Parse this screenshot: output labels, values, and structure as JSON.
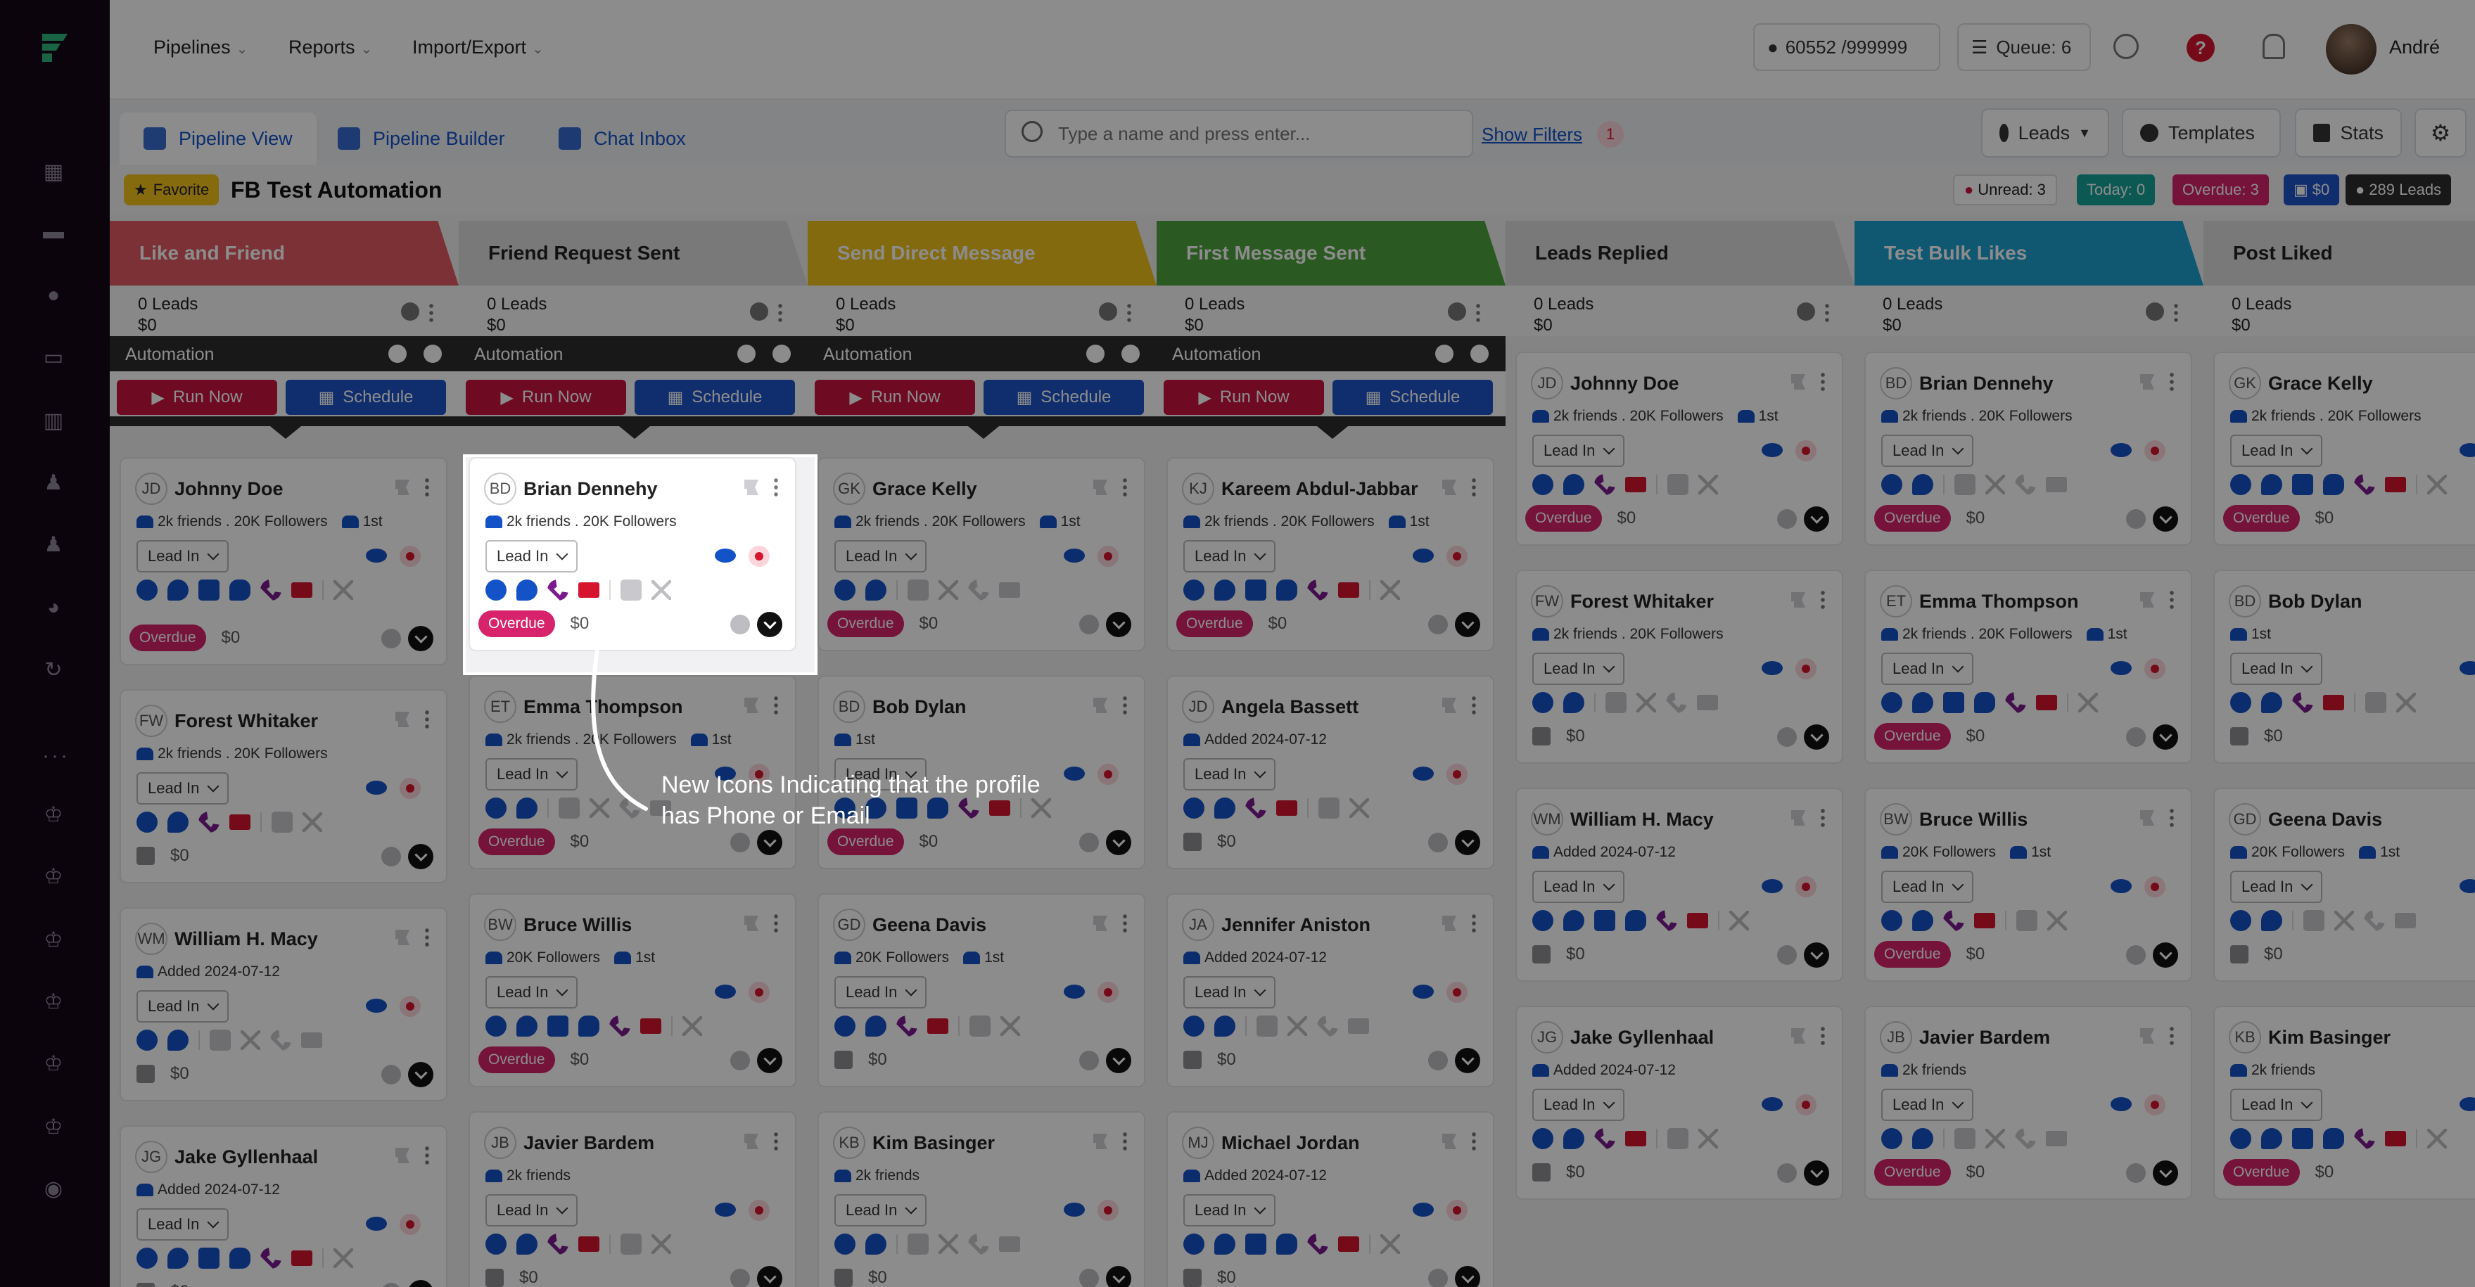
{
  "app": {
    "brand_icon": "logo-icon",
    "user": "André"
  },
  "nav": {
    "items": [
      "Pipelines",
      "Reports",
      "Import/Export"
    ],
    "counter": "60552 /999999",
    "queue": "Queue: 6",
    "help": "?"
  },
  "tabs": [
    "Pipeline View",
    "Pipeline Builder",
    "Chat Inbox"
  ],
  "search": {
    "placeholder": "Type a name and press enter...",
    "filters": "Show Filters",
    "filter_count": "1"
  },
  "actions": {
    "leads": "Leads",
    "templates": "Templates",
    "stats": "Stats"
  },
  "pipeline": {
    "favorite": "Favorite",
    "title": "FB Test Automation"
  },
  "stats": {
    "unread": "Unread: 3",
    "today": "Today: 0",
    "overdue": "Overdue: 3",
    "money": "$0",
    "leads": "289 Leads",
    "colors": {
      "unread": "#c9133f",
      "today": "#17a39a",
      "overdue": "#d6236b",
      "money": "#1e54c8",
      "leads": "#2d2d2f"
    }
  },
  "automation": {
    "label": "Automation",
    "run": "Run Now",
    "schedule": "Schedule"
  },
  "common": {
    "lead_status": "Lead In",
    "amount": "$0",
    "overdue": "Overdue"
  },
  "columns": [
    {
      "name": "Like and Friend",
      "leads": "0 Leads",
      "amount": "$0",
      "color": "#e05a63",
      "auto": true,
      "cards": [
        {
          "ini": "JD",
          "name": "Johnny Doe",
          "meta": "2k friends . 20K Followers",
          "conn": "1st",
          "overdue": true
        },
        {
          "ini": "FW",
          "name": "Forest Whitaker",
          "meta": "2k friends . 20K Followers",
          "conn": "",
          "overdue": false
        },
        {
          "ini": "WM",
          "name": "William H. Macy",
          "meta": "Added 2024-07-12",
          "conn": "",
          "overdue": false
        },
        {
          "ini": "JG",
          "name": "Jake Gyllenhaal",
          "meta": "Added 2024-07-12",
          "conn": "",
          "overdue": false
        }
      ]
    },
    {
      "name": "Friend Request Sent",
      "leads": "0 Leads",
      "amount": "$0",
      "color": "#dcdcdf",
      "auto": true,
      "cards": [
        {
          "ini": "BD",
          "name": "Brian Dennehy",
          "meta": "2k friends . 20K Followers",
          "conn": "",
          "overdue": true
        },
        {
          "ini": "ET",
          "name": "Emma Thompson",
          "meta": "2k friends . 20K Followers",
          "conn": "1st",
          "overdue": true
        },
        {
          "ini": "BW",
          "name": "Bruce Willis",
          "meta": "20K Followers",
          "conn": "1st",
          "overdue": true
        },
        {
          "ini": "JB",
          "name": "Javier Bardem",
          "meta": "2k friends",
          "conn": "",
          "overdue": false
        }
      ]
    },
    {
      "name": "Send Direct Message",
      "leads": "0 Leads",
      "amount": "$0",
      "color": "#f1c21b",
      "auto": true,
      "cards": [
        {
          "ini": "GK",
          "name": "Grace Kelly",
          "meta": "2k friends . 20K Followers",
          "conn": "1st",
          "overdue": true
        },
        {
          "ini": "BD",
          "name": "Bob Dylan",
          "meta": "1st",
          "conn": "",
          "overdue": true
        },
        {
          "ini": "GD",
          "name": "Geena Davis",
          "meta": "20K Followers",
          "conn": "1st",
          "overdue": false
        },
        {
          "ini": "KB",
          "name": "Kim Basinger",
          "meta": "2k friends",
          "conn": "",
          "overdue": false
        }
      ]
    },
    {
      "name": "First Message Sent",
      "leads": "0 Leads",
      "amount": "$0",
      "color": "#4ea33d",
      "auto": true,
      "cards": [
        {
          "ini": "KJ",
          "name": "Kareem Abdul-Jabbar",
          "meta": "2k friends . 20K Followers",
          "conn": "1st",
          "overdue": true
        },
        {
          "ini": "JD",
          "name": "Angela Bassett",
          "meta": "Added 2024-07-12",
          "conn": "",
          "overdue": false
        },
        {
          "ini": "JA",
          "name": "Jennifer Aniston",
          "meta": "Added 2024-07-12",
          "conn": "",
          "overdue": false
        },
        {
          "ini": "MJ",
          "name": "Michael Jordan",
          "meta": "Added 2024-07-12",
          "conn": "",
          "overdue": false
        }
      ]
    },
    {
      "name": "Leads Replied",
      "leads": "0 Leads",
      "amount": "$0",
      "color": "#dcdcdf",
      "auto": false,
      "cards": [
        {
          "ini": "JD",
          "name": "Johnny Doe",
          "meta": "2k friends . 20K Followers",
          "conn": "1st",
          "overdue": true
        },
        {
          "ini": "FW",
          "name": "Forest Whitaker",
          "meta": "2k friends . 20K Followers",
          "conn": "",
          "overdue": false
        },
        {
          "ini": "WM",
          "name": "William H. Macy",
          "meta": "Added 2024-07-12",
          "conn": "",
          "overdue": false
        },
        {
          "ini": "JG",
          "name": "Jake Gyllenhaal",
          "meta": "Added 2024-07-12",
          "conn": "",
          "overdue": false
        }
      ]
    },
    {
      "name": "Test Bulk Likes",
      "leads": "0 Leads",
      "amount": "$0",
      "color": "#1e9fd0",
      "auto": false,
      "cards": [
        {
          "ini": "BD",
          "name": "Brian Dennehy",
          "meta": "2k friends . 20K Followers",
          "conn": "",
          "overdue": true
        },
        {
          "ini": "ET",
          "name": "Emma Thompson",
          "meta": "2k friends . 20K Followers",
          "conn": "1st",
          "overdue": true
        },
        {
          "ini": "BW",
          "name": "Bruce Willis",
          "meta": "20K Followers",
          "conn": "1st",
          "overdue": true
        },
        {
          "ini": "JB",
          "name": "Javier Bardem",
          "meta": "2k friends",
          "conn": "",
          "overdue": true
        }
      ]
    },
    {
      "name": "Post Liked",
      "leads": "0 Leads",
      "amount": "$0",
      "color": "#dcdcdf",
      "auto": false,
      "cards": [
        {
          "ini": "GK",
          "name": "Grace Kelly",
          "meta": "2k friends . 20K Followers",
          "conn": "",
          "overdue": true
        },
        {
          "ini": "BD",
          "name": "Bob Dylan",
          "meta": "1st",
          "conn": "",
          "overdue": false
        },
        {
          "ini": "GD",
          "name": "Geena Davis",
          "meta": "20K Followers",
          "conn": "1st",
          "overdue": false
        },
        {
          "ini": "KB",
          "name": "Kim Basinger",
          "meta": "2k friends",
          "conn": "",
          "overdue": true
        }
      ]
    }
  ],
  "annotation": {
    "line1": "New Icons Indicating that the profile",
    "line2": "has Phone or Email"
  }
}
